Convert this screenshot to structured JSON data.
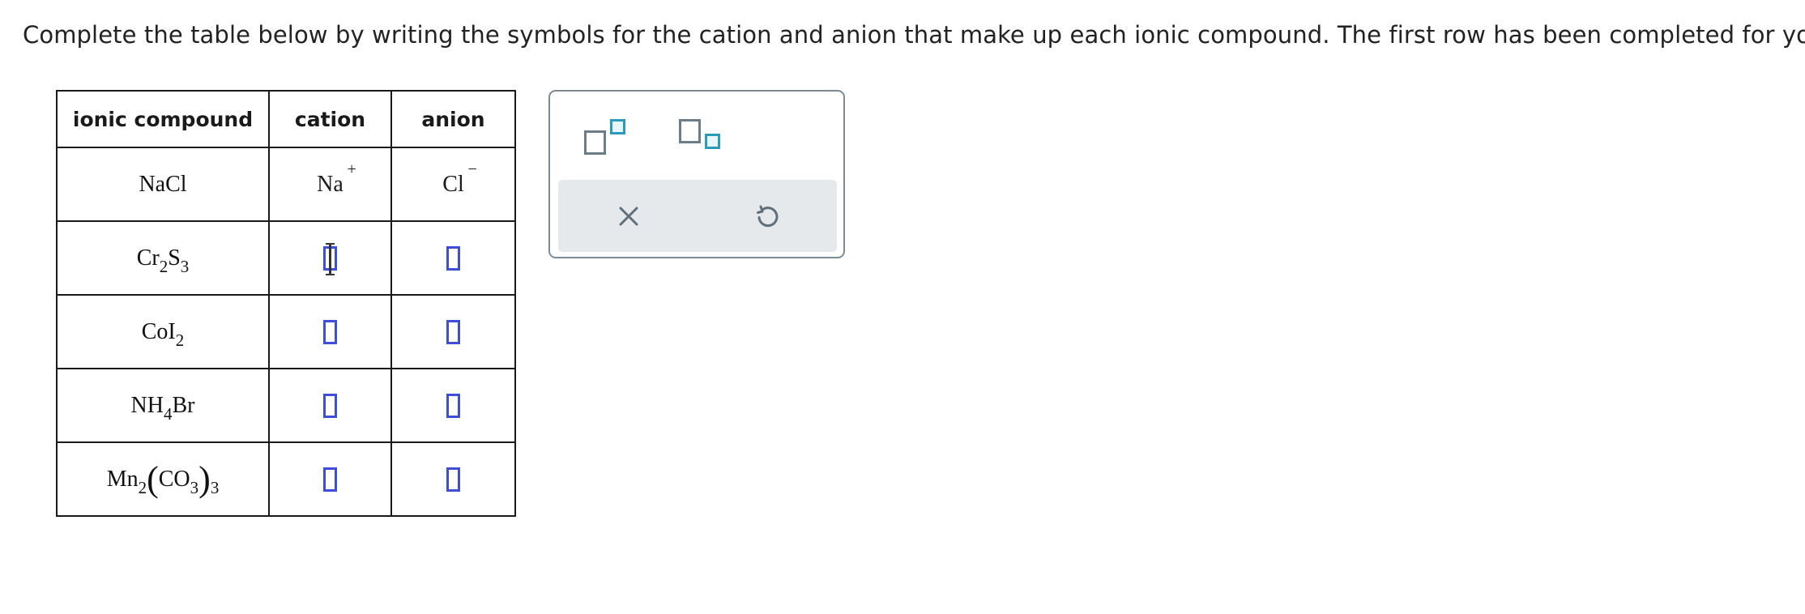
{
  "instructions": "Complete the table below by writing the symbols for the cation and anion that make up each ionic compound. The first row has been completed for you.",
  "table": {
    "headers": [
      "ionic compound",
      "cation",
      "anion"
    ],
    "example": {
      "compound": "NaCl",
      "cation_symbol": "Na",
      "cation_charge": "+",
      "anion_symbol": "Cl",
      "anion_charge": "−"
    },
    "rows": [
      {
        "compound_parts": [
          "Cr",
          "2",
          "S",
          "3"
        ],
        "cation": "",
        "anion": "",
        "cation_focused": true
      },
      {
        "compound_parts": [
          "CoI",
          "2"
        ],
        "cation": "",
        "anion": ""
      },
      {
        "compound_parts": [
          "NH",
          "4",
          "Br"
        ],
        "cation": "",
        "anion": ""
      },
      {
        "compound_parts": [
          "Mn",
          "2",
          "(",
          "CO",
          "3",
          ")",
          "3"
        ],
        "cation": "",
        "anion": ""
      }
    ]
  },
  "palette": {
    "buttons": [
      "superscript-button",
      "subscript-button",
      "clear-button",
      "undo-button"
    ],
    "icons": [
      "superscript-icon",
      "subscript-icon",
      "x-icon",
      "undo-icon"
    ],
    "colors": {
      "answer_box": "#3d4fd6",
      "accent_small_square": "#2a9bbd",
      "icon_gray": "#5f6f7b",
      "bar_bg": "#e5e9ec"
    }
  }
}
